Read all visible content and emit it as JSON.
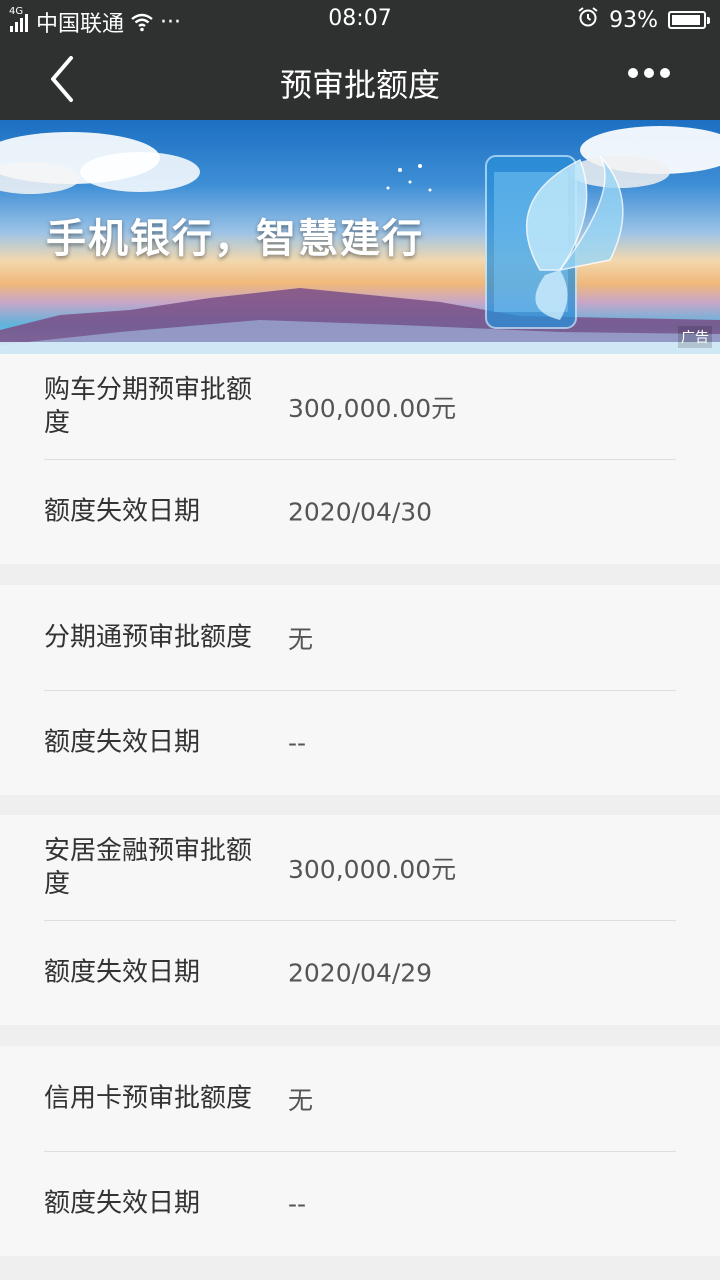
{
  "status_bar": {
    "network_tag": "4G",
    "carrier": "中国联通",
    "more_dots": "···",
    "time": "08:07",
    "battery": "93%"
  },
  "nav": {
    "title": "预审批额度",
    "back_icon": "chevron-left-icon",
    "more_icon": "more-dots-icon"
  },
  "banner": {
    "slogan": "手机银行，智慧建行",
    "ad_label": "广告"
  },
  "sections": [
    {
      "rows": [
        {
          "label": "购车分期预审批额度",
          "value": "300,000.00元"
        },
        {
          "label": "额度失效日期",
          "value": "2020/04/30"
        }
      ]
    },
    {
      "rows": [
        {
          "label": "分期通预审批额度",
          "value": "无"
        },
        {
          "label": "额度失效日期",
          "value": "--"
        }
      ]
    },
    {
      "rows": [
        {
          "label": "安居金融预审批额度",
          "value": "300,000.00元"
        },
        {
          "label": "额度失效日期",
          "value": "2020/04/29"
        }
      ]
    },
    {
      "rows": [
        {
          "label": "信用卡预审批额度",
          "value": "无"
        },
        {
          "label": "额度失效日期",
          "value": "--"
        }
      ]
    }
  ],
  "colors": {
    "nav_background": "#2f3030",
    "page_background": "#efefef",
    "card_background": "#f7f7f7"
  }
}
